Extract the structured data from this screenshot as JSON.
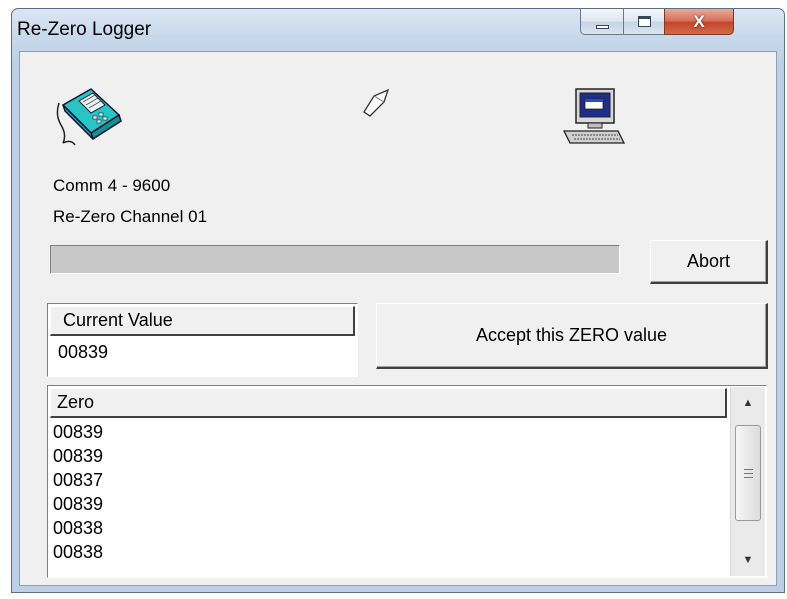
{
  "window": {
    "title": "Re-Zero Logger",
    "buttons": {
      "minimize_icon": "minimize-icon",
      "maximize_icon": "maximize-icon",
      "close_glyph": "X"
    }
  },
  "icons": {
    "device": "handheld-logger-icon",
    "cable": "data-cable-icon",
    "computer": "computer-icon"
  },
  "status": {
    "comm": "Comm 4 - 9600",
    "channel": "Re-Zero Channel 01"
  },
  "progress": {
    "value_percent": 0
  },
  "abort_label": "Abort",
  "current_value": {
    "header": "Current Value",
    "value": "00839"
  },
  "accept_label": "Accept this ZERO value",
  "zero_list": {
    "header": "Zero",
    "rows": [
      "00839",
      "00839",
      "00837",
      "00839",
      "00838",
      "00838"
    ]
  },
  "colors": {
    "dialog_bg": "#f0f0f0",
    "title_bar": "#bccfe6",
    "close_button": "#c4462b"
  }
}
